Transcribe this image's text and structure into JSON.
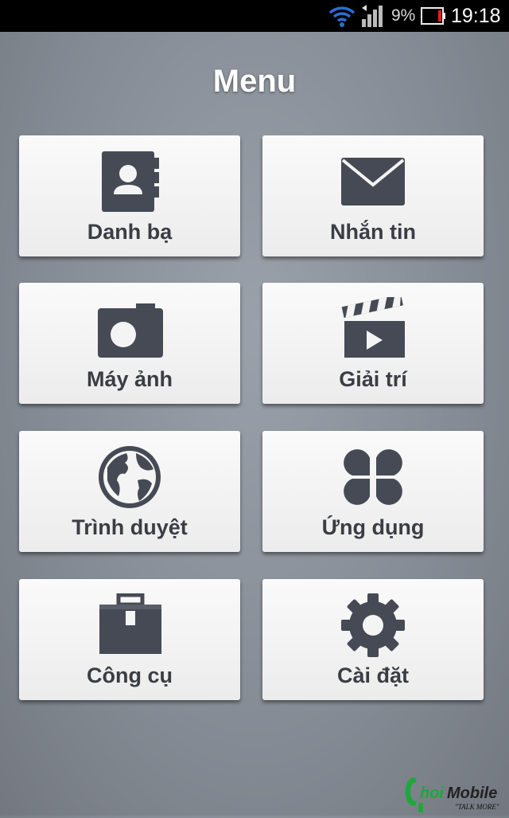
{
  "status_bar": {
    "battery_percent": "9%",
    "time": "19:18"
  },
  "page": {
    "title": "Menu"
  },
  "tiles": [
    {
      "label": "Danh bạ",
      "icon": "contacts-book-icon"
    },
    {
      "label": "Nhắn tin",
      "icon": "envelope-icon"
    },
    {
      "label": "Máy ảnh",
      "icon": "camera-icon"
    },
    {
      "label": "Giải trí",
      "icon": "clapperboard-icon"
    },
    {
      "label": "Trình duyệt",
      "icon": "globe-icon"
    },
    {
      "label": "Ứng dụng",
      "icon": "apps-grid-icon"
    },
    {
      "label": "Công cụ",
      "icon": "toolbox-icon"
    },
    {
      "label": "Cài đặt",
      "icon": "gear-icon"
    }
  ],
  "watermark": {
    "text": "ChoiMobile",
    "tagline": "TALK MORE"
  },
  "colors": {
    "icon": "#464a54",
    "label": "#3a3d44",
    "title": "#ffffff",
    "battery_low": "#e02020"
  }
}
